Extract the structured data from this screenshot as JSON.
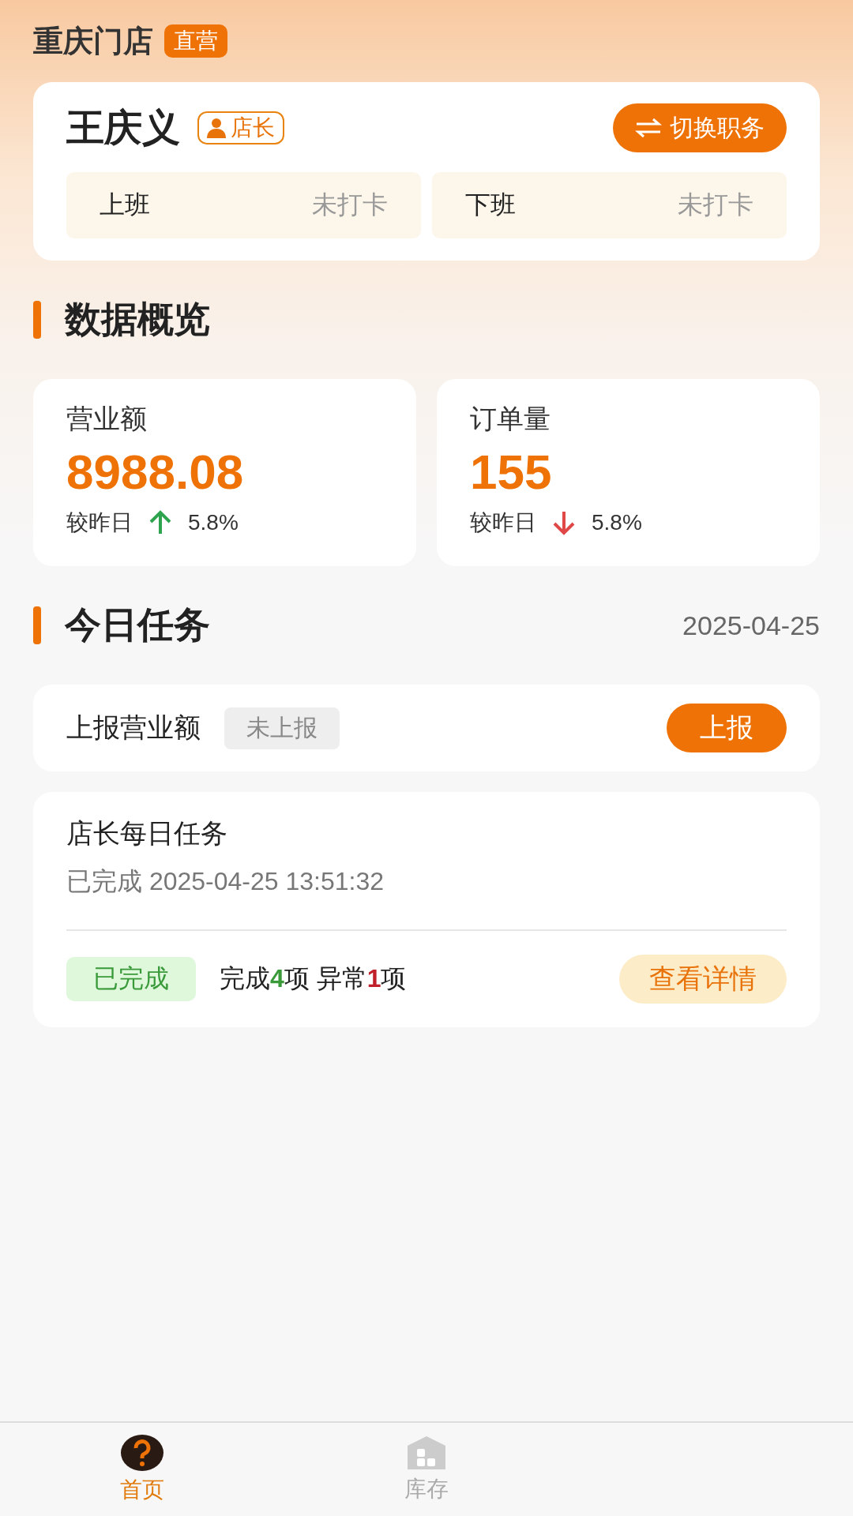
{
  "store": {
    "name": "重庆门店",
    "badge": "直营"
  },
  "user": {
    "name": "王庆义",
    "role": "店长",
    "switch_button": "切换职务"
  },
  "attendance": [
    {
      "label": "上班",
      "status": "未打卡"
    },
    {
      "label": "下班",
      "status": "未打卡"
    }
  ],
  "overview": {
    "title": "数据概览",
    "stats": [
      {
        "label": "营业额",
        "value": "8988.08",
        "compare_label": "较昨日",
        "kind": "up",
        "change": "5.8%"
      },
      {
        "label": "订单量",
        "value": "155",
        "compare_label": "较昨日",
        "kind": "down",
        "change": "5.8%"
      }
    ]
  },
  "tasks": {
    "title": "今日任务",
    "date": "2025-04-25",
    "report": {
      "label": "上报营业额",
      "status": "未上报",
      "button": "上报"
    },
    "daily": {
      "title": "店长每日任务",
      "completed_at": "已完成 2025-04-25 13:51:32",
      "status": "已完成",
      "summary": "完成**4**项 异常**1**项",
      "button": "查看详情"
    }
  },
  "tab_bar": [
    {
      "label": "首页",
      "kind": "home",
      "selected": true
    },
    {
      "label": "库存",
      "kind": "stock",
      "selected": false
    }
  ]
}
